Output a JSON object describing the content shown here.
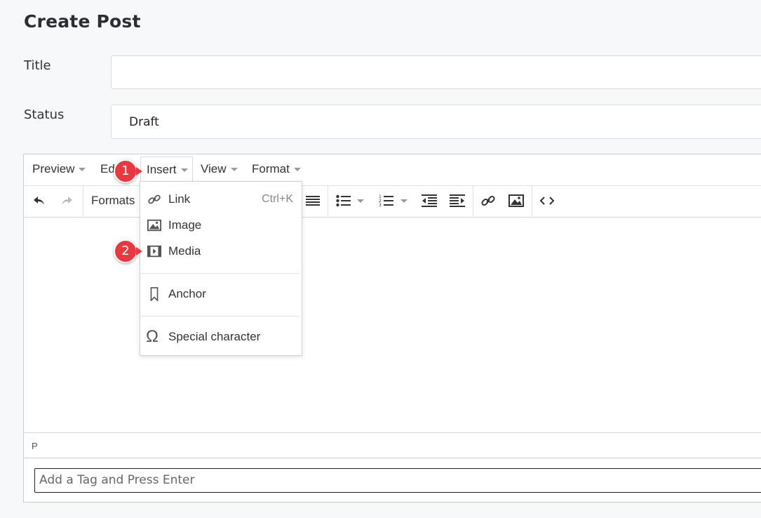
{
  "page": {
    "title": "Create Post"
  },
  "form": {
    "title_label": "Title",
    "title_value": "",
    "status_label": "Status",
    "status_value": "Draft"
  },
  "editor": {
    "menubar": [
      {
        "label": "Preview"
      },
      {
        "label": "Edit"
      },
      {
        "label": "Insert"
      },
      {
        "label": "View"
      },
      {
        "label": "Format"
      }
    ],
    "toolbar": {
      "formats_label": "Formats"
    },
    "statusbar_path": "P"
  },
  "insert_menu": {
    "items": [
      {
        "label": "Link",
        "shortcut": "Ctrl+K",
        "icon": "link-icon"
      },
      {
        "label": "Image",
        "icon": "image-icon"
      },
      {
        "label": "Media",
        "icon": "media-icon"
      },
      {
        "label": "Anchor",
        "icon": "bookmark-icon"
      },
      {
        "label": "Special character",
        "icon": "omega-icon"
      }
    ]
  },
  "tags": {
    "placeholder": "Add a Tag and Press Enter"
  },
  "annotations": [
    {
      "number": "1"
    },
    {
      "number": "2"
    }
  ],
  "colors": {
    "badge": "#e7393f",
    "border": "#d7dbe0"
  }
}
